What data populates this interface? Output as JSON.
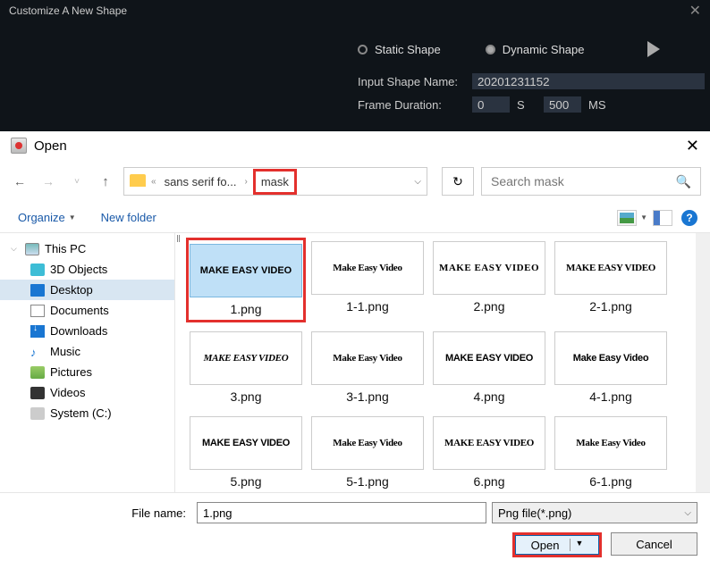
{
  "darkHeader": {
    "title": "Customize A New Shape",
    "staticShape": "Static Shape",
    "dynamicShape": "Dynamic Shape",
    "inputShapeLabel": "Input Shape Name:",
    "inputShapeValue": "20201231152",
    "frameDurationLabel": "Frame Duration:",
    "frameDurationValue": "0",
    "unitS": "S",
    "frameDurationMs": "500",
    "unitMs": "MS"
  },
  "dialog": {
    "title": "Open"
  },
  "breadcrumb": {
    "sep1": "«",
    "item1": "sans serif fo...",
    "item2": "mask"
  },
  "search": {
    "placeholder": "Search mask"
  },
  "toolbar": {
    "organize": "Organize",
    "newFolder": "New folder"
  },
  "sidebar": {
    "items": [
      {
        "label": "This PC",
        "top": true
      },
      {
        "label": "3D Objects"
      },
      {
        "label": "Desktop",
        "selected": true
      },
      {
        "label": "Documents"
      },
      {
        "label": "Downloads"
      },
      {
        "label": "Music"
      },
      {
        "label": "Pictures"
      },
      {
        "label": "Videos"
      },
      {
        "label": "System (C:)"
      }
    ]
  },
  "files": [
    {
      "label": "1.png",
      "text": "MAKE EASY VIDEO",
      "selected": true
    },
    {
      "label": "1-1.png",
      "text": "Make Easy Video"
    },
    {
      "label": "2.png",
      "text": "MAKE EASY VIDEO"
    },
    {
      "label": "2-1.png",
      "text": "MAKE EASY VIDEO"
    },
    {
      "label": "3.png",
      "text": "MAKE EASY VIDEO"
    },
    {
      "label": "3-1.png",
      "text": "Make Easy Video"
    },
    {
      "label": "4.png",
      "text": "MAKE EASY VIDEO"
    },
    {
      "label": "4-1.png",
      "text": "Make Easy Video"
    },
    {
      "label": "5.png",
      "text": "MAKE EASY VIDEO"
    },
    {
      "label": "5-1.png",
      "text": "Make Easy Video"
    },
    {
      "label": "6.png",
      "text": "MAKE EASY VIDEO"
    },
    {
      "label": "6-1.png",
      "text": "Make Easy Video"
    }
  ],
  "bottom": {
    "fileNameLabel": "File name:",
    "fileNameValue": "1.png",
    "fileType": "Png file(*.png)",
    "openBtn": "Open",
    "cancelBtn": "Cancel"
  }
}
